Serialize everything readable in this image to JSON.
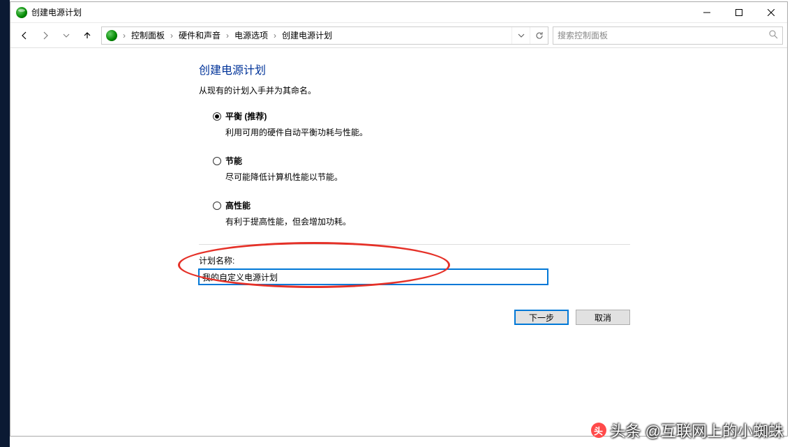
{
  "window": {
    "title": "创建电源计划"
  },
  "breadcrumb": {
    "items": [
      "控制面板",
      "硬件和声音",
      "电源选项",
      "创建电源计划"
    ]
  },
  "search": {
    "placeholder": "搜索控制面板"
  },
  "page": {
    "title": "创建电源计划",
    "subtitle": "从现有的计划入手并为其命名。"
  },
  "options": [
    {
      "label": "平衡 (推荐)",
      "desc": "利用可用的硬件自动平衡功耗与性能。",
      "checked": true
    },
    {
      "label": "节能",
      "desc": "尽可能降低计算机性能以节能。",
      "checked": false
    },
    {
      "label": "高性能",
      "desc": "有利于提高性能，但会增加功耗。",
      "checked": false
    }
  ],
  "plan_name": {
    "label": "计划名称:",
    "value": "我的自定义电源计划"
  },
  "buttons": {
    "next": "下一步",
    "cancel": "取消"
  },
  "watermark": "头条 @互联网上的小蜘蛛"
}
